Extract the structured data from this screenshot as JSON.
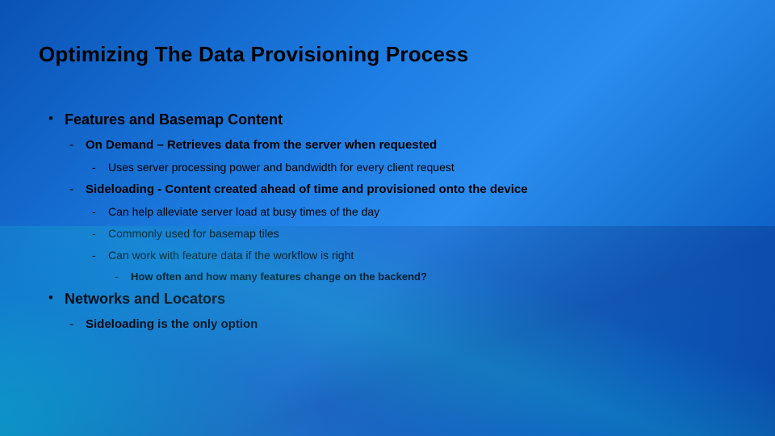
{
  "title": "Optimizing The Data Provisioning Process",
  "sections": [
    {
      "heading": "Features and Basemap Content",
      "items": [
        {
          "label": "On Demand – Retrieves data from the server when requested",
          "sub": [
            {
              "label": "Uses server processing power and bandwidth for every client request"
            }
          ]
        },
        {
          "label": "Sideloading - Content created ahead of time and provisioned onto the device",
          "sub": [
            {
              "label": "Can help alleviate server load at busy times of the day"
            },
            {
              "label": "Commonly used for basemap tiles"
            },
            {
              "label": "Can work with feature data if the workflow is right",
              "sub": [
                {
                  "label": "How often and how many features change on the backend?"
                }
              ]
            }
          ]
        }
      ]
    },
    {
      "heading": "Networks and Locators",
      "items": [
        {
          "label": "Sideloading is the only option"
        }
      ]
    }
  ]
}
